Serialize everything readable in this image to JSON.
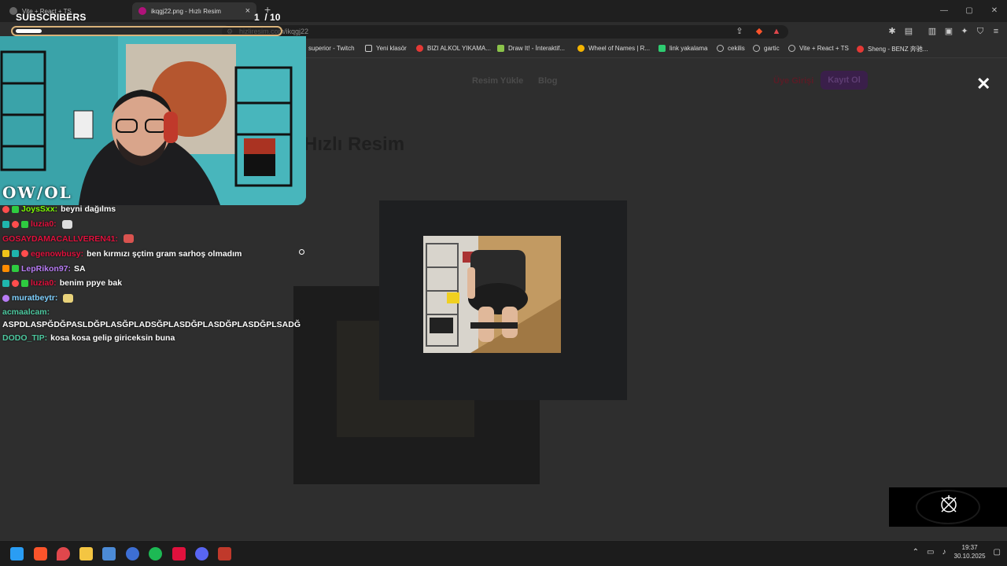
{
  "browser": {
    "tabs": [
      {
        "title": "Vite + React + TS",
        "active": false
      },
      {
        "title": "ikqgj22.png - Hızlı Resim",
        "active": true
      }
    ],
    "new_tab": "+",
    "window_controls": [
      "—",
      "▢",
      "✕"
    ],
    "url": "hizliresim.com/ikqgj22",
    "bookmarks": [
      {
        "label": "superior - Twitch",
        "icon": "bookmark-icon",
        "color": "#9146ff"
      },
      {
        "label": "Yeni klasör",
        "icon": "folder-icon",
        "color": "#cccccc"
      },
      {
        "label": "BIZI ALKOL YIKAMA...",
        "icon": "site-icon",
        "color": "#e53935"
      },
      {
        "label": "Draw It! - İnteraktif...",
        "icon": "site-icon",
        "color": "#8bc34a"
      },
      {
        "label": "Wheel of Names | R...",
        "icon": "site-icon",
        "color": "#f4b400"
      },
      {
        "label": "link yakalama",
        "icon": "site-icon",
        "color": "#2ecc71"
      },
      {
        "label": "cekilis",
        "icon": "globe-icon",
        "color": "#bbbbbb"
      },
      {
        "label": "gartic",
        "icon": "globe-icon",
        "color": "#bbbbbb"
      },
      {
        "label": "Vite + React + TS",
        "icon": "globe-icon",
        "color": "#bbbbbb"
      },
      {
        "label": "Sheng - BENZ 奔驰...",
        "icon": "site-icon",
        "color": "#e53935"
      }
    ]
  },
  "site": {
    "nav": [
      "Resim Yükle",
      "Blog"
    ],
    "login": "Üye Girişi",
    "register": "Kayıt Ol",
    "brand": "Hızlı Resim",
    "close": "✕"
  },
  "overlay": {
    "subscribers_label": "SUBSCRIBERS",
    "sub_current": "1",
    "sub_goal": "/ 10",
    "sub_progress": 0.1,
    "logo_text": "OW/OL"
  },
  "chat": [
    {
      "user": "JoysSxx:",
      "text": "beyni dağılms",
      "color": "#7cfc00",
      "badges": [
        "#ff4d4d",
        "#2ecc40"
      ]
    },
    {
      "user": "luzia0:",
      "text": "",
      "color": "#e0113d",
      "badges": [
        "#1fb5ad",
        "#ff4d4d",
        "#2ecc40"
      ],
      "emote": "#dddddd"
    },
    {
      "user": "GOSAYDAMACALLVEREN41:",
      "text": "",
      "color": "#e0113d",
      "badges": [],
      "emote": "#d9534f"
    },
    {
      "user": "egenowbusy:",
      "text": "ben kırmızı şçtim gram sarhoş olmadım",
      "color": "#e0113d",
      "badges": [
        "#f0c419",
        "#1fb5ad",
        "#ff4d4d"
      ]
    },
    {
      "user": "LepRikon97:",
      "text": "SA",
      "color": "#b87cf5",
      "badges": [
        "#ff8c00",
        "#2ecc40"
      ]
    },
    {
      "user": "luzia0:",
      "text": "benim ppye bak",
      "color": "#e0113d",
      "badges": [
        "#1fb5ad",
        "#ff4d4d",
        "#2ecc40"
      ]
    },
    {
      "user": "muratbeytr:",
      "text": "",
      "color": "#7fd1ff",
      "badges": [
        "#b87cf5"
      ],
      "emote": "#e8d27a"
    },
    {
      "user": "acmaalcam:",
      "text": "",
      "color": "#4ec9a0",
      "badges": []
    },
    {
      "user": "",
      "text": "ASPDLASPĞDĞPASLDĞPLASĞPLADSĞPLASDĞPLASDĞPLASDĞPLSADĞ",
      "color": "#ffffff",
      "badges": []
    },
    {
      "user": "DODO_TIP:",
      "text": "kosa kosa gelip giriceksin buna",
      "color": "#4ec9a0",
      "badges": []
    }
  ],
  "taskbar": {
    "apps": [
      {
        "name": "windows-start",
        "color": "#2a9df4"
      },
      {
        "name": "brave-browser",
        "color": "#fb542b"
      },
      {
        "name": "maps-pin",
        "color": "#e0474c"
      },
      {
        "name": "file-explorer",
        "color": "#f4c542"
      },
      {
        "name": "steam",
        "color": "#4c8bd6"
      },
      {
        "name": "app-blue",
        "color": "#3d6fd4"
      },
      {
        "name": "spotify",
        "color": "#1db954"
      },
      {
        "name": "app-red",
        "color": "#e0113d"
      },
      {
        "name": "discord",
        "color": "#5865f2"
      },
      {
        "name": "app-stream",
        "color": "#c0392b"
      }
    ],
    "time": "19:37",
    "date": "30.10.2025"
  }
}
